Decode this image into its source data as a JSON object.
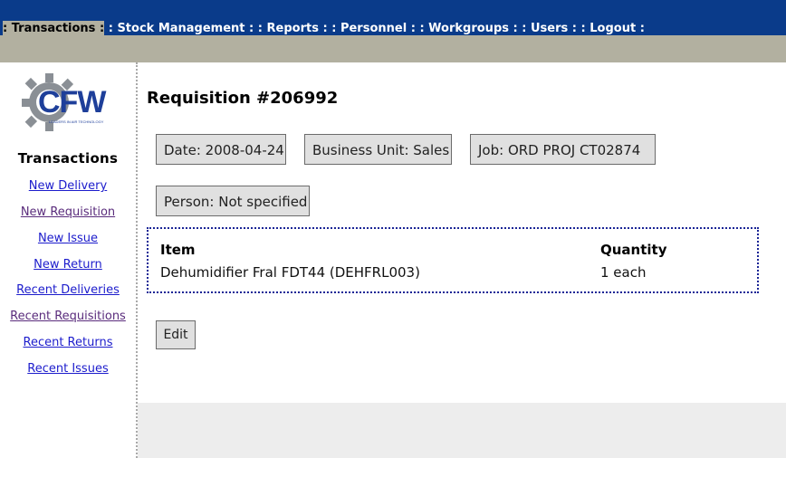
{
  "nav": {
    "items": [
      {
        "label": "Transactions",
        "active": true
      },
      {
        "label": "Stock Management"
      },
      {
        "label": "Reports"
      },
      {
        "label": "Personnel"
      },
      {
        "label": "Workgroups"
      },
      {
        "label": "Users"
      },
      {
        "label": "Logout"
      }
    ],
    "separator_left": ":",
    "separator_right": ":"
  },
  "sidebar": {
    "logo_text": "CFW",
    "logo_tagline": "LEADERS IN AIR TECHNOLOGY",
    "title": "Transactions",
    "links": [
      {
        "label": "New Delivery"
      },
      {
        "label": "New Requisition"
      },
      {
        "label": "New Issue"
      },
      {
        "label": "New Return"
      },
      {
        "label": "Recent Deliveries"
      },
      {
        "label": "Recent Requisitions"
      },
      {
        "label": "Recent Returns"
      },
      {
        "label": "Recent Issues"
      }
    ]
  },
  "main": {
    "title": "Requisition #206992",
    "fields": {
      "date": "Date:  2008-04-24",
      "business_unit": "Business Unit:  Sales",
      "job": "Job:  ORD PROJ CT02874",
      "person": "Person:  Not specified"
    },
    "items_table": {
      "headers": {
        "item": "Item",
        "quantity": "Quantity"
      },
      "rows": [
        {
          "item": "Dehumidifier Fral FDT44 (DEHFRL003)",
          "quantity": "1 each"
        }
      ]
    },
    "edit_label": "Edit"
  },
  "colors": {
    "topbar": "#0a3b8a",
    "subbar": "#b2b0a0",
    "link": "#1c1ccc",
    "visited_link": "#5a2c7c",
    "table_border": "#1b2596",
    "logo_blue": "#1e3f9a",
    "logo_gear": "#8a8f95"
  }
}
